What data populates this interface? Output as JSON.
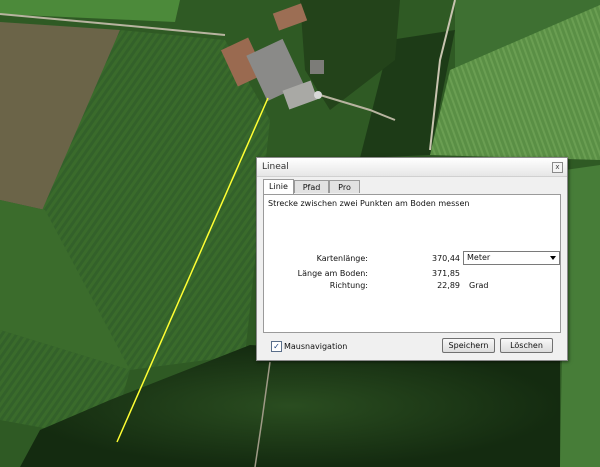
{
  "dialog": {
    "title": "Lineal",
    "close_symbol": "x",
    "tabs": [
      {
        "label": "Linie",
        "active": true
      },
      {
        "label": "Pfad",
        "active": false
      },
      {
        "label": "Pro",
        "active": false
      }
    ],
    "description": "Strecke zwischen zwei Punkten am Boden messen",
    "map_length": {
      "label": "Kartenlänge:",
      "value": "370,44",
      "unit_selected": "Meter"
    },
    "ground_length": {
      "label": "Länge am Boden:",
      "value": "371,85"
    },
    "heading": {
      "label": "Richtung:",
      "value": "22,89",
      "unit": "Grad"
    },
    "mouse_nav": {
      "label": "Mausnavigation",
      "checked": true,
      "check_symbol": "✓"
    },
    "save_label": "Speichern",
    "delete_label": "Löschen"
  },
  "colors": {
    "measure_line": "#ffff33",
    "field_dark": "#2e5a22",
    "field_light": "#4f8a3a",
    "forest": "#1c3a16"
  },
  "icons": [
    "close-icon",
    "chevron-down-icon",
    "checkmark-icon"
  ]
}
